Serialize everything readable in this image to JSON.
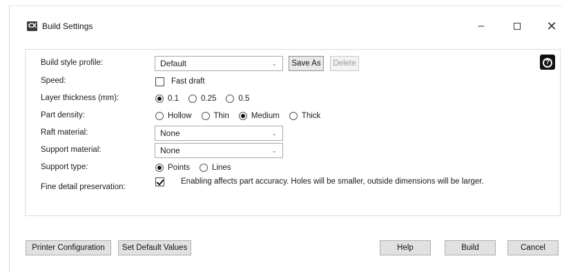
{
  "window": {
    "title": "Build Settings",
    "icon_text": "CX",
    "controls": {
      "minimize": "–",
      "maximize": "□",
      "close": "✕"
    }
  },
  "form": {
    "build_style_profile": {
      "label": "Build style profile:",
      "value": "Default",
      "save_as": "Save As",
      "delete": "Delete"
    },
    "speed": {
      "label": "Speed:",
      "fast_draft_label": "Fast draft",
      "fast_draft_checked": false
    },
    "layer_thickness": {
      "label": "Layer thickness (mm):",
      "options": [
        "0.1",
        "0.25",
        "0.5"
      ],
      "selected": "0.1"
    },
    "part_density": {
      "label": "Part density:",
      "options": [
        "Hollow",
        "Thin",
        "Medium",
        "Thick"
      ],
      "selected": "Medium"
    },
    "raft_material": {
      "label": "Raft material:",
      "value": "None"
    },
    "support_material": {
      "label": "Support material:",
      "value": "None"
    },
    "support_type": {
      "label": "Support type:",
      "options": [
        "Points",
        "Lines"
      ],
      "selected": "Points"
    },
    "fine_detail": {
      "label": "Fine detail preservation:",
      "checked": true,
      "note": "Enabling affects part accuracy. Holes will be smaller, outside dimensions will be larger."
    }
  },
  "footer": {
    "printer_configuration": "Printer Configuration",
    "set_default_values": "Set Default Values",
    "help": "Help",
    "build": "Build",
    "cancel": "Cancel"
  },
  "icons": {
    "help": "help-circle-icon",
    "app": "app-logo-icon"
  },
  "colors": {
    "accent": "#111111",
    "border": "#a9a9a9",
    "button_bg": "#e1e1e1"
  }
}
